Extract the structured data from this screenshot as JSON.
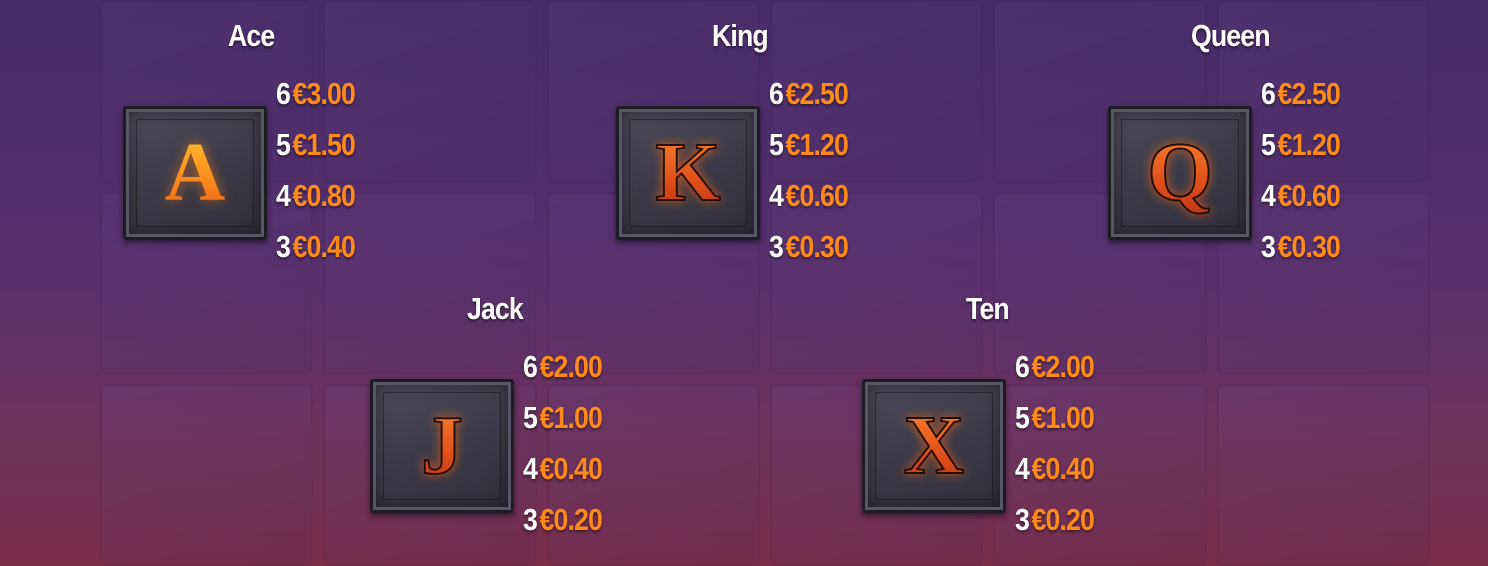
{
  "symbols": [
    {
      "name": "Ace",
      "letter": "A",
      "payouts": [
        {
          "count": "6",
          "value": "€3.00"
        },
        {
          "count": "5",
          "value": "€1.50"
        },
        {
          "count": "4",
          "value": "€0.80"
        },
        {
          "count": "3",
          "value": "€0.40"
        }
      ]
    },
    {
      "name": "King",
      "letter": "K",
      "payouts": [
        {
          "count": "6",
          "value": "€2.50"
        },
        {
          "count": "5",
          "value": "€1.20"
        },
        {
          "count": "4",
          "value": "€0.60"
        },
        {
          "count": "3",
          "value": "€0.30"
        }
      ]
    },
    {
      "name": "Queen",
      "letter": "Q",
      "payouts": [
        {
          "count": "6",
          "value": "€2.50"
        },
        {
          "count": "5",
          "value": "€1.20"
        },
        {
          "count": "4",
          "value": "€0.60"
        },
        {
          "count": "3",
          "value": "€0.30"
        }
      ]
    },
    {
      "name": "Jack",
      "letter": "J",
      "payouts": [
        {
          "count": "6",
          "value": "€2.00"
        },
        {
          "count": "5",
          "value": "€1.00"
        },
        {
          "count": "4",
          "value": "€0.40"
        },
        {
          "count": "3",
          "value": "€0.20"
        }
      ]
    },
    {
      "name": "Ten",
      "letter": "X",
      "payouts": [
        {
          "count": "6",
          "value": "€2.00"
        },
        {
          "count": "5",
          "value": "€1.00"
        },
        {
          "count": "4",
          "value": "€0.40"
        },
        {
          "count": "3",
          "value": "€0.20"
        }
      ]
    }
  ],
  "colors": {
    "label_text": "#ffffff",
    "payout_value": "#ff8a1c",
    "tile_stone": "#3b3a46"
  }
}
